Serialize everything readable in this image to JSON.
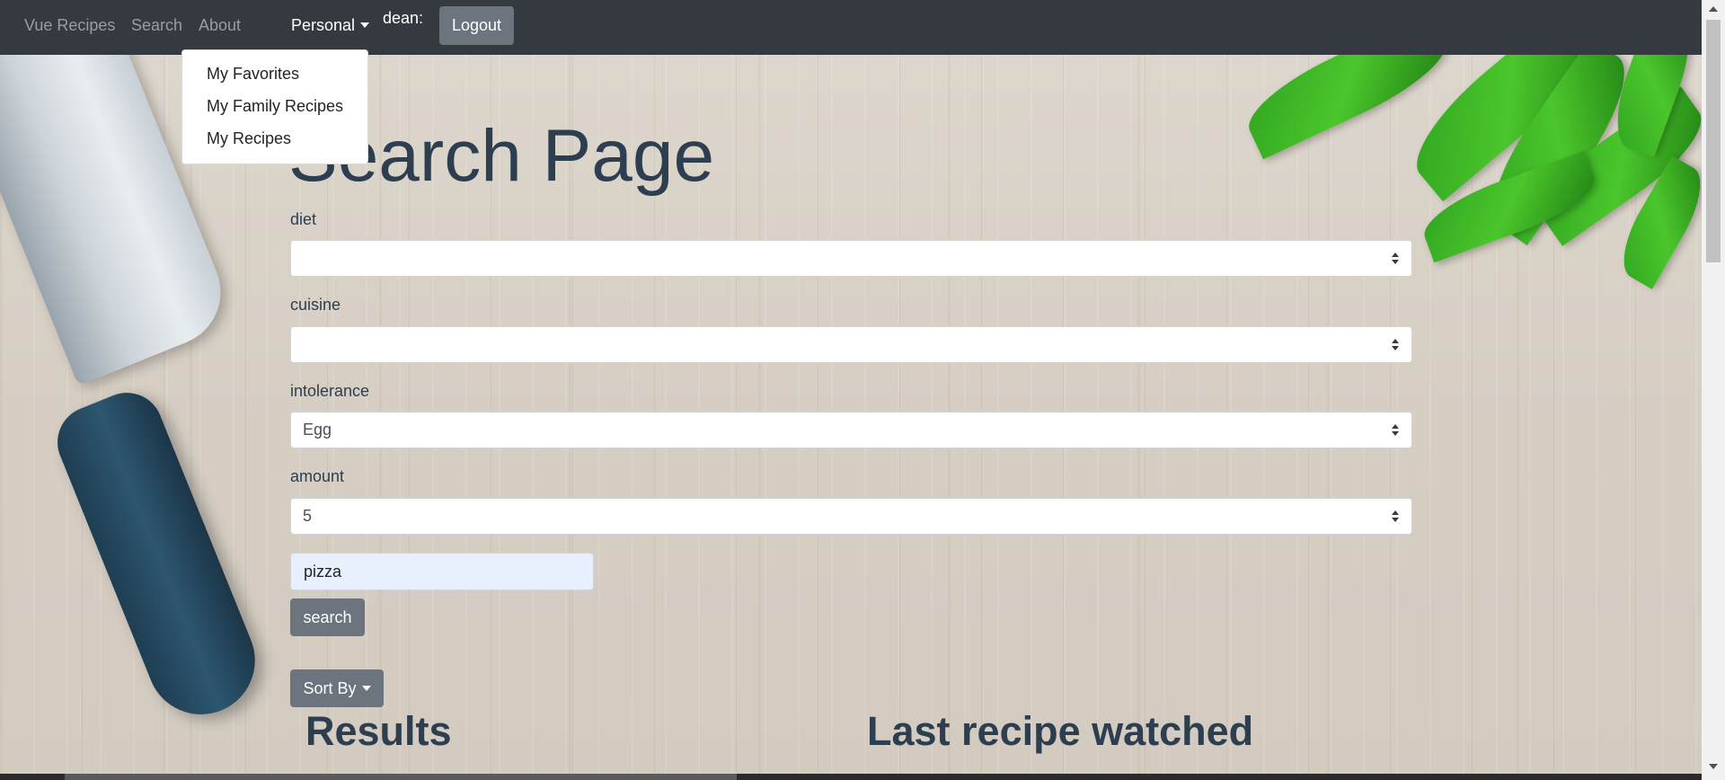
{
  "navbar": {
    "brand": "Vue Recipes",
    "links": [
      "Search",
      "About"
    ],
    "personal_label": "Personal",
    "user_label": "dean:",
    "logout_label": "Logout"
  },
  "dropdown": {
    "items": [
      "My Favorites",
      "My Family Recipes",
      "My Recipes"
    ]
  },
  "main": {
    "title": "Search Page",
    "fields": [
      {
        "label": "diet",
        "value": ""
      },
      {
        "label": "cuisine",
        "value": ""
      },
      {
        "label": "intolerance",
        "value": "Egg"
      },
      {
        "label": "amount",
        "value": "5"
      }
    ],
    "query_value": "pizza",
    "search_button": "search",
    "sort_button": "Sort By",
    "results_title": "Results",
    "last_watched_title": "Last recipe watched"
  }
}
